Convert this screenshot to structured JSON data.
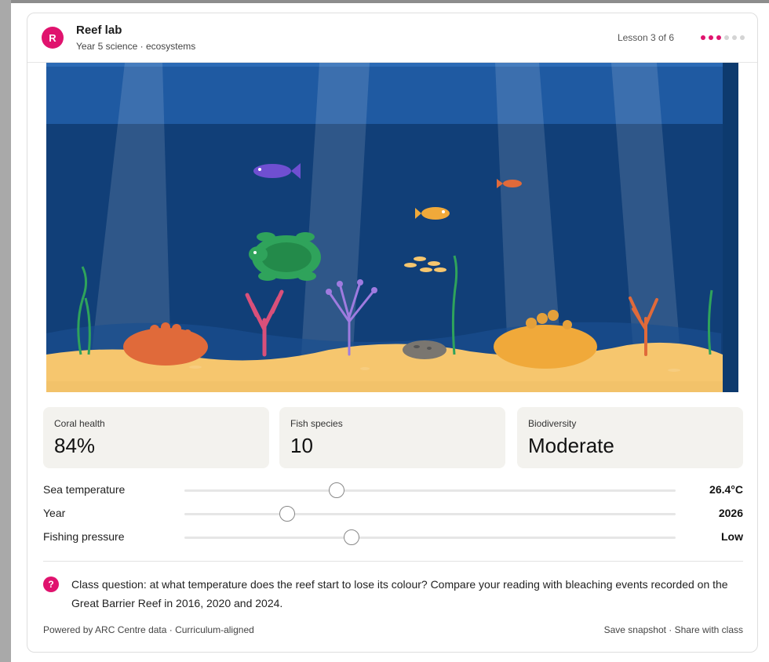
{
  "header": {
    "avatar_letter": "R",
    "title": "Reef lab",
    "subtitle": "Year 5 science · ecosystems",
    "lesson": "Lesson 3 of 6",
    "lesson_current": 3,
    "lesson_total": 6
  },
  "stats": [
    {
      "label": "Coral health",
      "value": "84%"
    },
    {
      "label": "Fish species",
      "value": "10"
    },
    {
      "label": "Biodiversity",
      "value": "Moderate"
    }
  ],
  "controls": [
    {
      "label": "Sea temperature",
      "value": "26.4°C",
      "position": 0.31
    },
    {
      "label": "Year",
      "value": "2026",
      "position": 0.21
    },
    {
      "label": "Fishing pressure",
      "value": "Low",
      "position": 0.34
    }
  ],
  "question": {
    "icon": "?",
    "text": "Class question: at what temperature does the reef start to lose its colour? Compare your reading with bleaching events recorded on the Great Barrier Reef in 2016, 2020 and 2024."
  },
  "footer": {
    "left": "Powered by ARC Centre data · Curriculum-aligned",
    "right": "Save snapshot · Share with class"
  },
  "colors": {
    "accent": "#e0136e",
    "water": "#124a86",
    "sand": "#f6c66e"
  }
}
